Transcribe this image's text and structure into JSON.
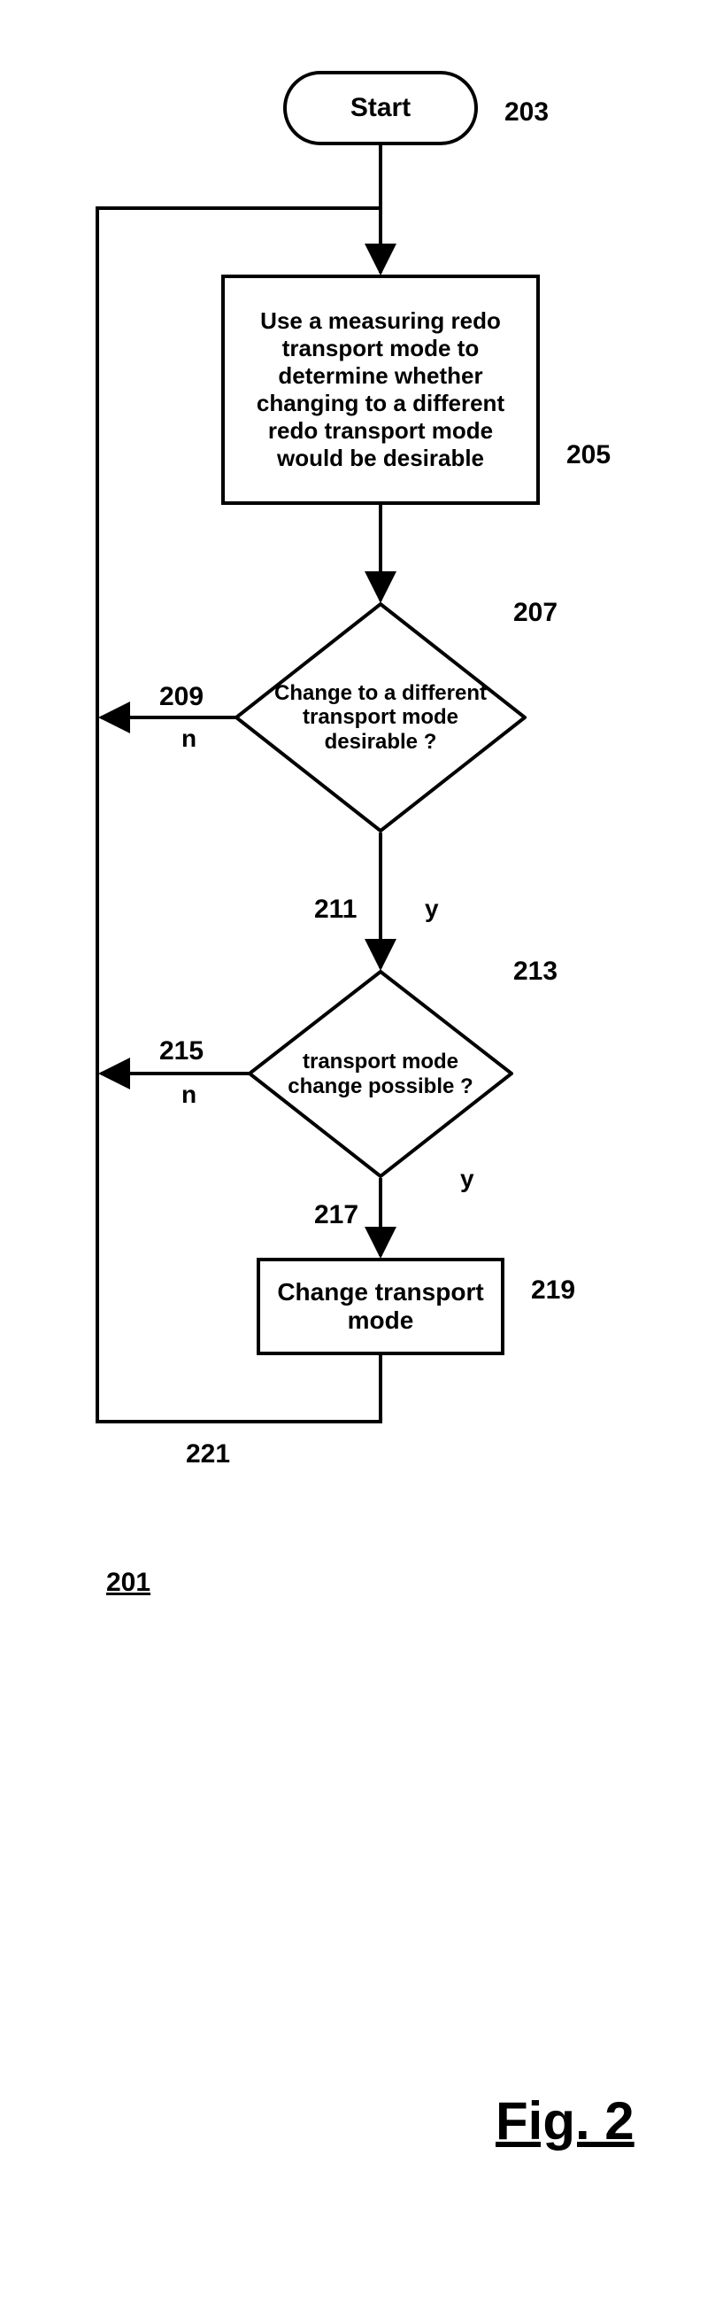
{
  "chart_data": {
    "type": "flowchart",
    "title": "Fig. 2",
    "ref": "201",
    "nodes": [
      {
        "id": "203",
        "kind": "terminator",
        "label": "Start"
      },
      {
        "id": "205",
        "kind": "process",
        "label": "Use a measuring redo transport mode to determine whether changing to a different redo transport mode would be desirable"
      },
      {
        "id": "207",
        "kind": "decision",
        "label": "Change to a different transport mode desirable ?"
      },
      {
        "id": "213",
        "kind": "decision",
        "label": "transport mode change possible ?"
      },
      {
        "id": "219",
        "kind": "process",
        "label": "Change transport mode"
      }
    ],
    "edges": [
      {
        "from": "203",
        "to": "205",
        "label": ""
      },
      {
        "from": "205",
        "to": "207",
        "label": ""
      },
      {
        "id": "209",
        "from": "207",
        "to": "205",
        "label": "n"
      },
      {
        "id": "211",
        "from": "207",
        "to": "213",
        "label": "y"
      },
      {
        "id": "215",
        "from": "213",
        "to": "205",
        "label": "n"
      },
      {
        "id": "217",
        "from": "213",
        "to": "219",
        "label": "y"
      },
      {
        "id": "221",
        "from": "219",
        "to": "205",
        "label": ""
      }
    ]
  },
  "labels": {
    "n203": "203",
    "n205": "205",
    "n207": "207",
    "n209": "209",
    "n211": "211",
    "n213": "213",
    "n215": "215",
    "n217": "217",
    "n219": "219",
    "n221": "221",
    "figref": "201",
    "figcap": "Fig. 2",
    "yes": "y",
    "no": "n"
  }
}
